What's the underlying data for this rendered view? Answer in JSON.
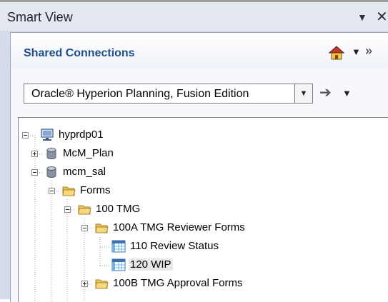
{
  "window": {
    "title": "Smart View",
    "menu_glyph": "▼",
    "close_glyph": "✕"
  },
  "connections": {
    "label": "Shared Connections",
    "dropdown_glyph": "▼",
    "more_glyph": "»"
  },
  "provider": {
    "selected": "Oracle® Hyperion Planning, Fusion Edition",
    "combo_glyph": "▼",
    "go_glyph": "➔",
    "go_menu_glyph": "▼"
  },
  "tree": {
    "nodes": [
      {
        "label": "hyprdp01",
        "icon": "server-icon"
      },
      {
        "label": "McM_Plan",
        "icon": "database-icon"
      },
      {
        "label": "mcm_sal",
        "icon": "database-icon"
      },
      {
        "label": "Forms",
        "icon": "folder-icon"
      },
      {
        "label": "100 TMG",
        "icon": "folder-icon"
      },
      {
        "label": "100A TMG Reviewer Forms",
        "icon": "folder-icon"
      },
      {
        "label": "110 Review Status",
        "icon": "form-grid-icon"
      },
      {
        "label": "120 WIP",
        "icon": "form-grid-icon"
      },
      {
        "label": "100B TMG Approval Forms",
        "icon": "folder-icon"
      }
    ]
  }
}
